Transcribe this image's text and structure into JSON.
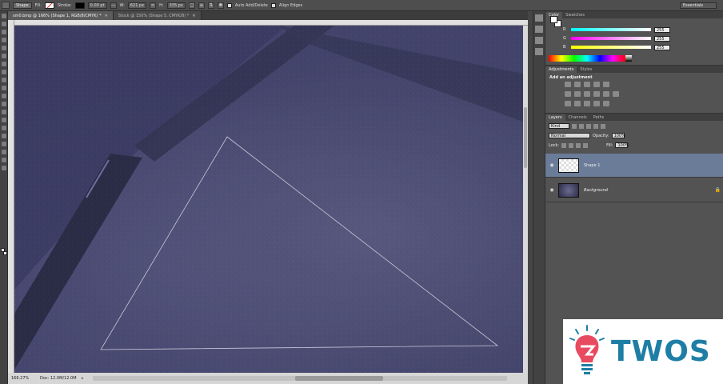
{
  "options_bar": {
    "mode": "Shape",
    "fill_label": "Fill:",
    "stroke_label": "Stroke:",
    "stroke_width": "0.00 pt",
    "width_label": "W:",
    "width_value": "621 px",
    "height_label": "H:",
    "height_value": "335 px",
    "auto_add_delete": "Auto Add/Delete",
    "align_edges": "Align Edges",
    "workspace": "Essentials"
  },
  "tabs": [
    {
      "label": "sm0.bmp @ 166% (Shape 1, RGB/8/CMYK) *",
      "active": true
    },
    {
      "label": "Stock @ 150% (Shape 5, CMYK/8) *",
      "active": false
    }
  ],
  "status": {
    "zoom": "166.27%",
    "doc": "Doc: 12.0M/12.0M"
  },
  "color_panel": {
    "tabs": [
      "Color",
      "Swatches"
    ],
    "channels": [
      {
        "ch": "R",
        "value": "255"
      },
      {
        "ch": "G",
        "value": "255"
      },
      {
        "ch": "B",
        "value": "255"
      }
    ]
  },
  "adjustments_panel": {
    "tabs": [
      "Adjustments",
      "Styles"
    ],
    "title": "Add an adjustment"
  },
  "layers_panel": {
    "tabs": [
      "Layers",
      "Channels",
      "Paths"
    ],
    "kind": "Kind",
    "blend_mode": "Normal",
    "opacity_label": "Opacity:",
    "opacity_value": "100%",
    "lock_label": "Lock:",
    "fill_label": "Fill:",
    "fill_value": "100%",
    "layers": [
      {
        "name": "Shape 1",
        "selected": true
      },
      {
        "name": "Background",
        "selected": false
      }
    ]
  },
  "watermark": {
    "text": "TWOS",
    "color": "#1f7ea5"
  }
}
